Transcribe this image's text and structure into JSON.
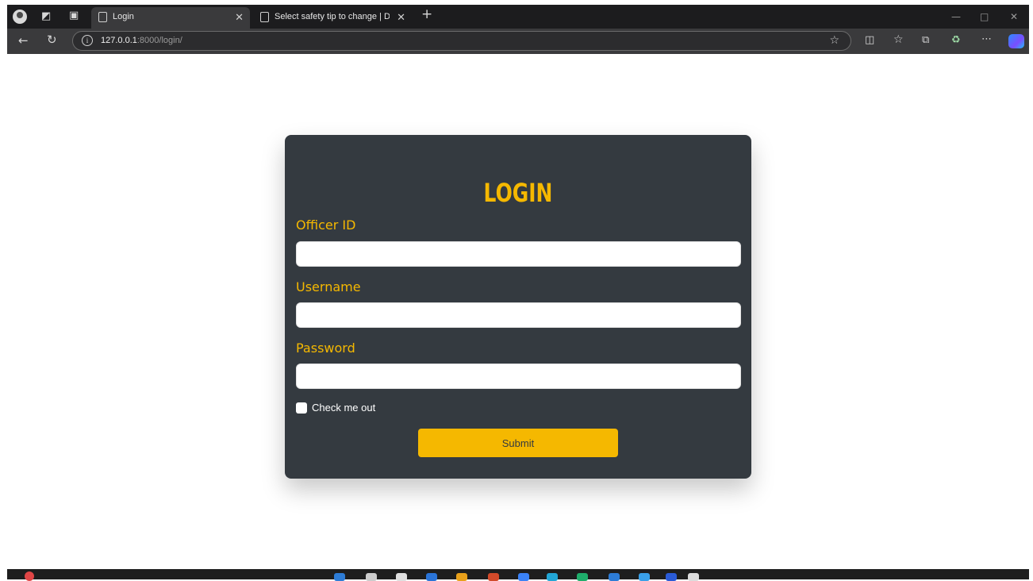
{
  "browser": {
    "tabs": [
      {
        "title": "Login",
        "active": true
      },
      {
        "title": "Select safety tip to change | Djang",
        "active": false
      }
    ],
    "url_host": "127.0.0.1",
    "url_rest": ":8000/login/",
    "icons": {
      "profile": "profile-icon",
      "workspaces": "workspaces-icon",
      "tab_actions": "tab-actions-icon",
      "back": "back-arrow-icon",
      "refresh": "refresh-icon",
      "site_info": "info-icon",
      "favorite": "star-icon",
      "split": "split-screen-icon",
      "favorites": "favorites-icon",
      "collections": "collections-icon",
      "extensions": "extensions-icon",
      "more": "more-icon",
      "copilot": "copilot-icon"
    }
  },
  "login": {
    "title": "LOGIN",
    "officer_label": "Officer ID",
    "username_label": "Username",
    "password_label": "Password",
    "officer_value": "",
    "username_value": "",
    "password_value": "",
    "check_label": "Check me out",
    "check_checked": false,
    "submit_label": "Submit"
  },
  "colors": {
    "accent": "#f5b800",
    "card": "#343a40",
    "chrome": "#3a3a3c"
  }
}
